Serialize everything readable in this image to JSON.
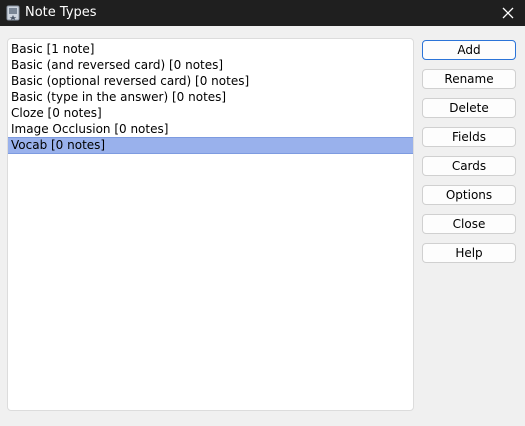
{
  "window": {
    "title": "Note Types"
  },
  "note_types": [
    {
      "label": "Basic [1 note]",
      "selected": false
    },
    {
      "label": "Basic (and reversed card) [0 notes]",
      "selected": false
    },
    {
      "label": "Basic (optional reversed card) [0 notes]",
      "selected": false
    },
    {
      "label": "Basic (type in the answer) [0 notes]",
      "selected": false
    },
    {
      "label": "Cloze [0 notes]",
      "selected": false
    },
    {
      "label": "Image Occlusion [0 notes]",
      "selected": false
    },
    {
      "label": "Vocab [0 notes]",
      "selected": true
    }
  ],
  "buttons": {
    "add": "Add",
    "rename": "Rename",
    "delete": "Delete",
    "fields": "Fields",
    "cards": "Cards",
    "options": "Options",
    "close": "Close",
    "help": "Help"
  },
  "icons": {
    "app": "anki-app-icon",
    "close": "close-icon"
  },
  "colors": {
    "titlebar": "#1f1f1f",
    "selection": "#99b1ec",
    "default_button_border": "#2b74d8"
  }
}
